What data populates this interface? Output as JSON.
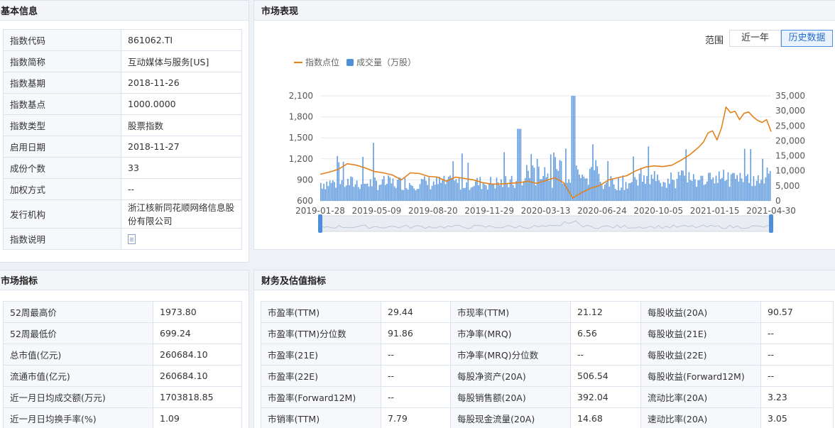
{
  "basic": {
    "title": "基本信息",
    "rows": [
      {
        "k": "指数代码",
        "v": "861062.TI"
      },
      {
        "k": "指数简称",
        "v": "互动媒体与服务[US]"
      },
      {
        "k": "指数基期",
        "v": "2018-11-26"
      },
      {
        "k": "指数基点",
        "v": "1000.0000"
      },
      {
        "k": "指数类型",
        "v": "股票指数"
      },
      {
        "k": "启用日期",
        "v": "2018-11-27"
      },
      {
        "k": "成份个数",
        "v": "33"
      },
      {
        "k": "加权方式",
        "v": "--"
      },
      {
        "k": "发行机构",
        "v": "浙江核新同花顺网络信息股份有限公司"
      },
      {
        "k": "指数说明",
        "v": ""
      }
    ],
    "doc_icon": "document-icon"
  },
  "market": {
    "title": "市场表现",
    "range_label": "范围",
    "btn_1y": "近一年",
    "btn_hist": "历史数据",
    "legend_line": "指数点位",
    "legend_bar": "成交量（万股）",
    "colors": {
      "line": "#e4811d",
      "bar": "#4f8fda"
    }
  },
  "chart_data": {
    "type": "line",
    "x_ticks": [
      "2019-01-28",
      "2019-05-09",
      "2019-08-20",
      "2019-11-29",
      "2020-03-13",
      "2020-06-24",
      "2020-10-05",
      "2021-01-15",
      "2021-04-30"
    ],
    "y_left_ticks": [
      "600",
      "900",
      "1,200",
      "1,500",
      "1,800",
      "2,100"
    ],
    "y_right_ticks": [
      "0",
      "5,000",
      "10,000",
      "15,000",
      "20,000",
      "25,000",
      "30,000",
      "35,000"
    ],
    "ylim_left": [
      600,
      2100
    ],
    "ylim_right": [
      0,
      35000
    ],
    "series": [
      {
        "name": "指数点位",
        "kind": "line",
        "x": [
          0,
          0.02,
          0.04,
          0.06,
          0.08,
          0.1,
          0.12,
          0.14,
          0.16,
          0.18,
          0.2,
          0.22,
          0.24,
          0.26,
          0.28,
          0.3,
          0.32,
          0.34,
          0.36,
          0.38,
          0.4,
          0.42,
          0.44,
          0.46,
          0.48,
          0.5,
          0.52,
          0.54,
          0.56,
          0.58,
          0.6,
          0.62,
          0.64,
          0.66,
          0.68,
          0.7,
          0.72,
          0.74,
          0.76,
          0.78,
          0.8,
          0.82,
          0.84,
          0.85,
          0.86,
          0.87,
          0.88,
          0.89,
          0.9,
          0.91,
          0.92,
          0.93,
          0.94,
          0.95,
          0.96,
          0.97,
          0.98,
          0.99,
          1.0
        ],
        "values": [
          980,
          1010,
          1050,
          1130,
          1110,
          1070,
          1020,
          1000,
          970,
          900,
          1000,
          990,
          950,
          940,
          880,
          940,
          920,
          900,
          860,
          840,
          840,
          850,
          860,
          880,
          850,
          890,
          930,
          860,
          640,
          720,
          780,
          820,
          900,
          930,
          960,
          1030,
          1080,
          1100,
          1090,
          1110,
          1180,
          1260,
          1370,
          1440,
          1570,
          1600,
          1470,
          1640,
          1940,
          1860,
          1880,
          1760,
          1850,
          1870,
          1800,
          1750,
          1720,
          1760,
          1590
        ]
      },
      {
        "name": "成交量（万股）",
        "kind": "bar",
        "note": "daily volume bars, typical range 3,000–12,000, peak about 35,000 near 2020-03"
      }
    ]
  },
  "indicators": {
    "title": "市场指标",
    "rows": [
      {
        "k": "52周最高价",
        "v": "1973.80"
      },
      {
        "k": "52周最低价",
        "v": "699.24"
      },
      {
        "k": "总市值(亿元)",
        "v": "260684.10"
      },
      {
        "k": "流通市值(亿元)",
        "v": "260684.10"
      },
      {
        "k": "近一月日均成交额(万元)",
        "v": "1703818.85"
      },
      {
        "k": "近一月日均换手率(%)",
        "v": "1.09"
      }
    ]
  },
  "finance": {
    "title": "财务及估值指标",
    "rows": [
      [
        "市盈率(TTM)",
        "29.44",
        "市现率(TTM)",
        "21.12",
        "每股收益(20A)",
        "90.57"
      ],
      [
        "市盈率(TTM)分位数",
        "91.86",
        "市净率(MRQ)",
        "6.56",
        "每股收益(21E)",
        "--"
      ],
      [
        "市盈率(21E)",
        "--",
        "市净率(MRQ)分位数",
        "--",
        "每股收益(22E)",
        "--"
      ],
      [
        "市盈率(22E)",
        "--",
        "每股净资产(20A)",
        "506.54",
        "每股收益(Forward12M)",
        "--"
      ],
      [
        "市盈率(Forward12M)",
        "--",
        "每股销售额(20A)",
        "392.04",
        "流动比率(20A)",
        "3.23"
      ],
      [
        "市销率(TTM)",
        "7.79",
        "每股现金流量(20A)",
        "14.68",
        "速动比率(20A)",
        "3.05"
      ]
    ]
  }
}
